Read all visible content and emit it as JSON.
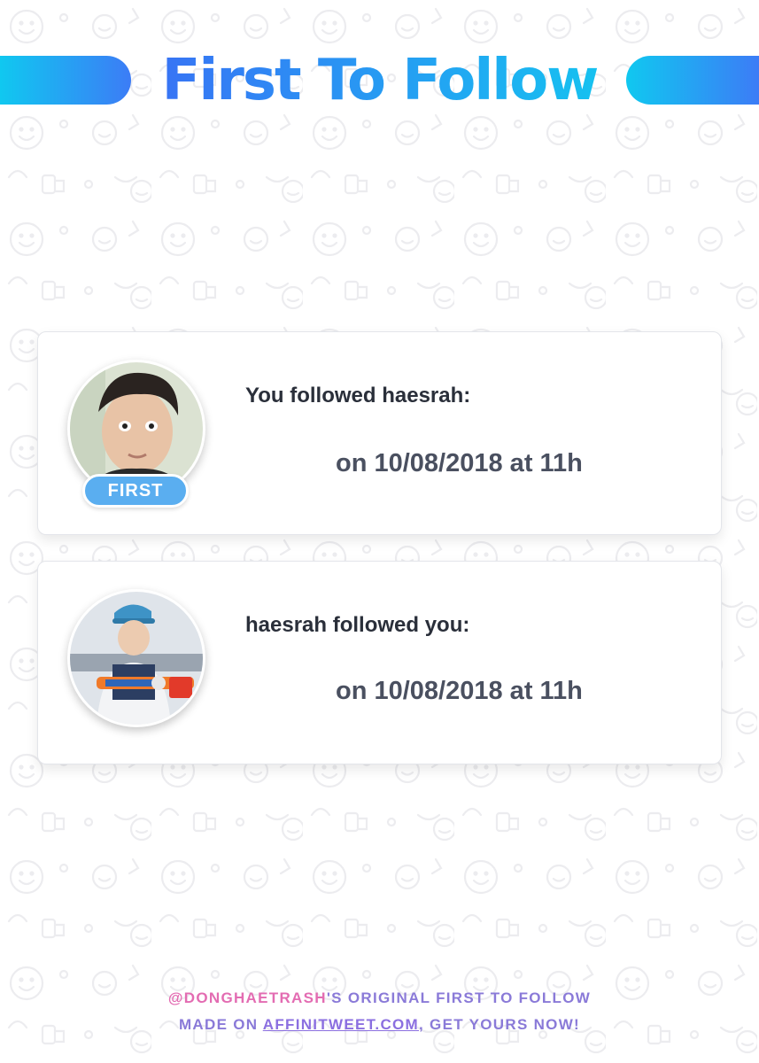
{
  "header": {
    "title": "First To Follow"
  },
  "cards": [
    {
      "label": "You followed haesrah:",
      "date": "on 10/08/2018 at 11h",
      "badge": "FIRST",
      "avatar_icon": "profile-photo"
    },
    {
      "label": "haesrah followed you:",
      "date": "on 10/08/2018 at 11h",
      "avatar_icon": "profile-photo"
    }
  ],
  "footer": {
    "handle": "@DONGHAETRASH",
    "line1_rest": "'S ORIGINAL FIRST TO FOLLOW",
    "line2_prefix": "MADE ON ",
    "link": "AFFINITWEET.COM",
    "line2_suffix": ", GET YOURS NOW!"
  },
  "colors": {
    "gradient_start": "#10c8f0",
    "gradient_end": "#3c7cf6",
    "badge": "#5aaef0",
    "footer_handle": "#e36cb2",
    "footer_text": "#8a7ad8"
  }
}
